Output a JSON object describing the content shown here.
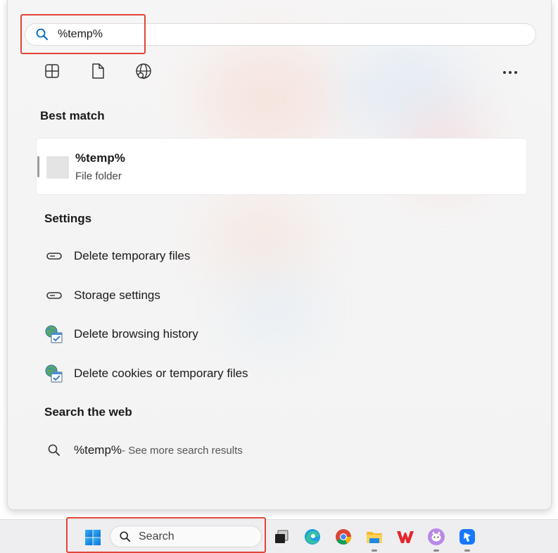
{
  "search": {
    "query": "%temp%",
    "placeholder": ""
  },
  "filters": [
    {
      "icon": "apps-grid-icon"
    },
    {
      "icon": "document-icon"
    },
    {
      "icon": "web-globe-icon"
    }
  ],
  "more_icon": "more-ellipsis-icon",
  "best_match": {
    "title": "Best match",
    "name": "%temp%",
    "kind": "File folder"
  },
  "settings": {
    "title": "Settings",
    "items": [
      {
        "label": "Delete temporary files",
        "icon": "storage-drive-icon"
      },
      {
        "label": "Storage settings",
        "icon": "storage-drive-icon"
      },
      {
        "label": "Delete browsing history",
        "icon": "internet-options-icon"
      },
      {
        "label": "Delete cookies or temporary files",
        "icon": "internet-options-icon"
      }
    ]
  },
  "web": {
    "title": "Search the web",
    "query": "%temp%",
    "suffix": " - See more search results"
  },
  "taskbar": {
    "search_label": "Search",
    "apps": [
      "task-view-icon",
      "edge-icon",
      "chrome-icon",
      "file-explorer-icon",
      "wps-office-icon",
      "cat-app-icon",
      "blue-app-icon"
    ]
  },
  "colors": {
    "highlight_box": "#e14438",
    "accent_blue": "#0067c0"
  }
}
